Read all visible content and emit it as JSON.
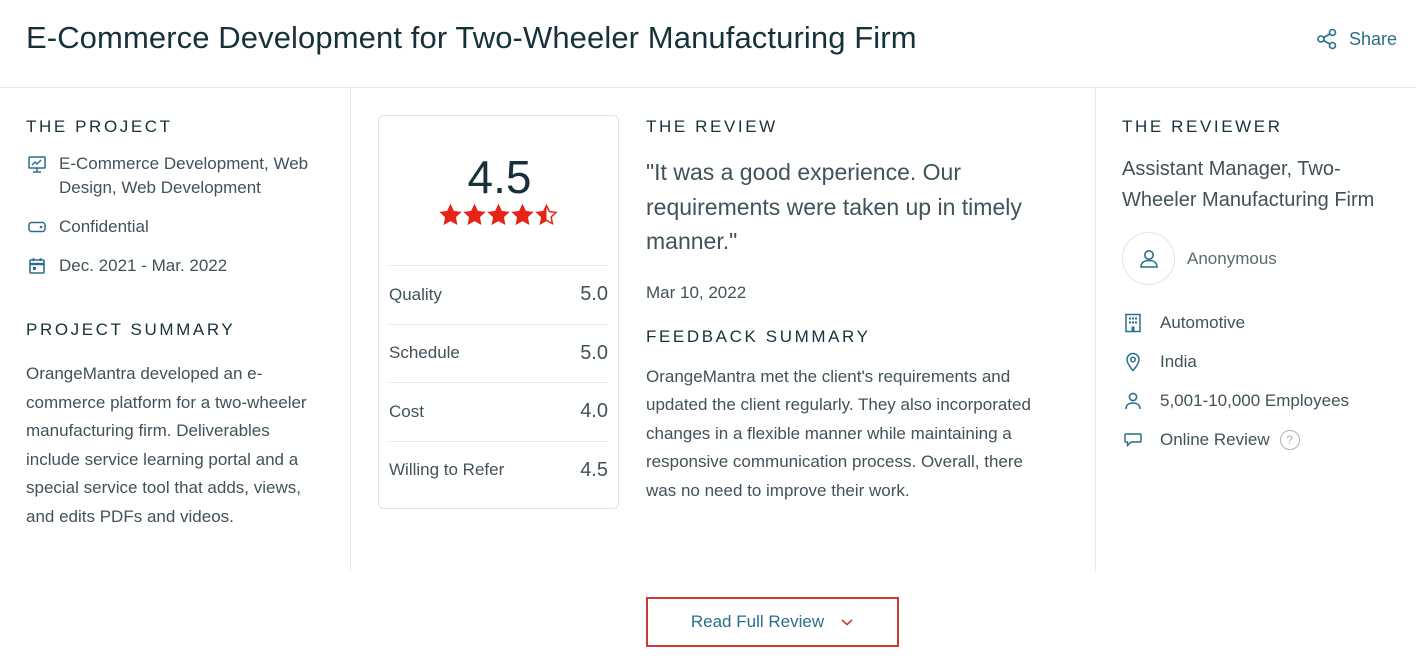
{
  "header": {
    "title": "E-Commerce Development for Two-Wheeler Manufacturing Firm",
    "share_label": "Share"
  },
  "project": {
    "label": "THE PROJECT",
    "services": "E-Commerce Development, Web Design, Web Development",
    "budget": "Confidential",
    "dates": "Dec. 2021 - Mar. 2022",
    "summary_label": "PROJECT SUMMARY",
    "summary": "OrangeMantra developed an e-commerce platform for a two-wheeler manufacturing firm. Deliverables include service learning portal and a special service tool that adds, views, and edits PDFs and videos."
  },
  "scores": {
    "overall": "4.5",
    "overall_rating": 4.5,
    "max_stars": 5,
    "star_color": "#e62415",
    "rows": [
      {
        "label": "Quality",
        "value": "5.0"
      },
      {
        "label": "Schedule",
        "value": "5.0"
      },
      {
        "label": "Cost",
        "value": "4.0"
      },
      {
        "label": "Willing to Refer",
        "value": "4.5"
      }
    ]
  },
  "review": {
    "label": "THE REVIEW",
    "quote": "\"It was a good experience. Our requirements were taken up in timely manner.\"",
    "date": "Mar 10, 2022",
    "feedback_label": "FEEDBACK SUMMARY",
    "feedback": "OrangeMantra met the client's requirements and updated the client regularly. They also incorporated changes in a flexible manner while maintaining a responsive communication process. Overall, there was no need to improve their work."
  },
  "reviewer": {
    "label": "THE REVIEWER",
    "title": "Assistant Manager, Two-Wheeler Manufacturing Firm",
    "name": "Anonymous",
    "industry": "Automotive",
    "location": "India",
    "size": "5,001-10,000 Employees",
    "review_type": "Online Review",
    "help_glyph": "?"
  },
  "actions": {
    "read_full_review": "Read Full Review"
  },
  "colors": {
    "link": "#2a6f89",
    "button_border": "#c83b37",
    "text": "#17313b"
  }
}
